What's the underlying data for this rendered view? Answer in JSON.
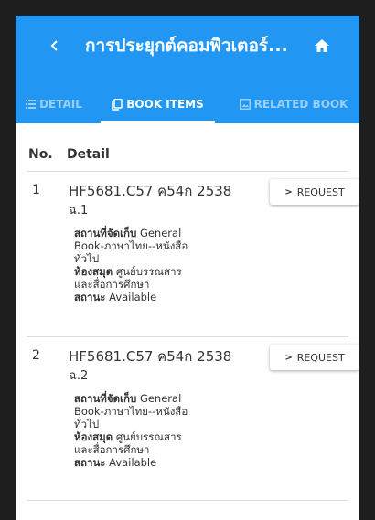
{
  "appbar": {
    "title": "การประยุกต์คอมพิวเตอร์...",
    "color": "#2196f3"
  },
  "tabs": [
    {
      "label": "DETAIL",
      "icon": "list-icon",
      "active": false
    },
    {
      "label": "BOOK ITEMS",
      "icon": "copy-icon",
      "active": true
    },
    {
      "label": "RELATED BOOK",
      "icon": "image-icon",
      "active": false
    }
  ],
  "table": {
    "col_no": "No.",
    "col_detail": "Detail"
  },
  "items": [
    {
      "no": "1",
      "callno": "HF5681.C57 ค54ก 2538",
      "copy": "ฉ.1",
      "location_label": "สถานที่จัดเก็บ",
      "location_line1": "General",
      "location_line2": "Book-ภาษาไทย--หนังสือ",
      "location_line3": "ทั่วไป",
      "library_label": "ห้องสมุด",
      "library_line1": "ศูนย์บรรณสาร",
      "library_line2": "และสื่อการศึกษา",
      "status_label": "สถานะ",
      "status_value": "Available",
      "button": "REQUEST"
    },
    {
      "no": "2",
      "callno": "HF5681.C57 ค54ก 2538",
      "copy": "ฉ.2",
      "location_label": "สถานที่จัดเก็บ",
      "location_line1": "General",
      "location_line2": "Book-ภาษาไทย--หนังสือ",
      "location_line3": "ทั่วไป",
      "library_label": "ห้องสมุด",
      "library_line1": "ศูนย์บรรณสาร",
      "library_line2": "และสื่อการศึกษา",
      "status_label": "สถานะ",
      "status_value": "Available",
      "button": "REQUEST"
    }
  ]
}
